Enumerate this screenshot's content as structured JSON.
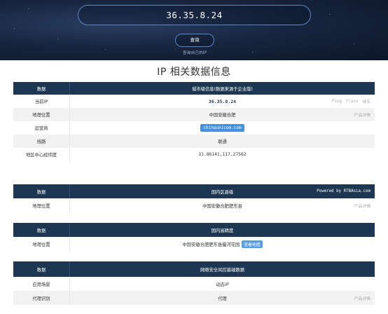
{
  "hero": {
    "ip_input_value": "36.35.8.24",
    "query_button": "查询",
    "query_self_link": "查询自己的IP"
  },
  "page_title": "IP 相关数据信息",
  "sections": {
    "city": {
      "header_label": "数据",
      "header_title": "城市级信息(数据来源于企业版)",
      "rows": {
        "current_ip": {
          "label": "当前IP",
          "value": "36.35.8.24",
          "ping": "Ping",
          "trace": "Trace",
          "domain": "域名"
        },
        "location": {
          "label": "地理位置",
          "value": "中国安徽合肥",
          "detail": "产品详情"
        },
        "isp": {
          "label": "运营商",
          "value": "chinaunicom.com"
        },
        "line": {
          "label": "线路",
          "value": "联通"
        },
        "coords": {
          "label": "地区中心经纬度",
          "value": "31.86141,117.27562"
        }
      }
    },
    "county": {
      "header_label": "数据",
      "header_title": "国内区县级",
      "powered": "Powered by RTBAsia.com",
      "rows": {
        "location": {
          "label": "地理位置",
          "value": "中国安徽合肥肥东县",
          "detail": "产品详情"
        }
      }
    },
    "high_precision": {
      "header_label": "数据",
      "header_title": "国内高精度",
      "rows": {
        "location": {
          "label": "地理位置",
          "value": "中国安徽合肥肥东县撮河花园",
          "view_map": "查看地图"
        }
      }
    },
    "security": {
      "header_label": "数据",
      "header_title": "网络安全风控基础数据",
      "rows": {
        "scene": {
          "label": "应用场景",
          "value": "动态IP"
        },
        "proxy": {
          "label": "代理识别",
          "value": "代理",
          "detail": "产品详情"
        }
      }
    }
  },
  "colors": {
    "header_bg": "#1d3752",
    "chip_bg": "#4a90d9",
    "hero_bg": "#17253f"
  }
}
